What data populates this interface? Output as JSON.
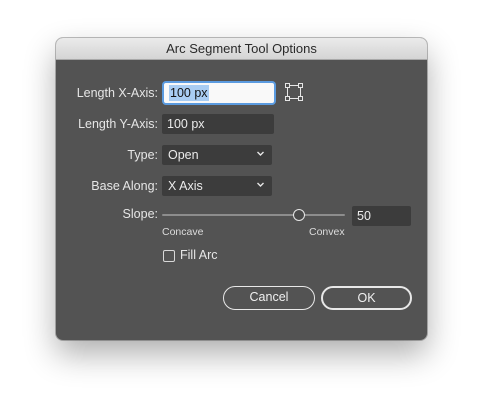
{
  "dialog": {
    "title": "Arc Segment Tool Options"
  },
  "fields": {
    "length_x_label": "Length X-Axis:",
    "length_x_value": "100 px",
    "length_y_label": "Length Y-Axis:",
    "length_y_value": "100 px",
    "type_label": "Type:",
    "type_value": "Open",
    "base_along_label": "Base Along:",
    "base_along_value": "X Axis",
    "slope_label": "Slope:",
    "slope_value": "50",
    "slope_fraction": 0.75,
    "slope_min_label": "Concave",
    "slope_max_label": "Convex",
    "fill_arc_label": "Fill Arc",
    "fill_arc_checked": false
  },
  "buttons": {
    "cancel": "Cancel",
    "ok": "OK"
  },
  "icons": {
    "reference_point": "reference-point-locator-icon",
    "dropdown": "chevron-down-icon"
  },
  "colors": {
    "dialog_bg": "#535353",
    "field_bg": "#3c3c3c",
    "focus_ring": "#5b9be0",
    "selection": "#a9cdf3"
  }
}
